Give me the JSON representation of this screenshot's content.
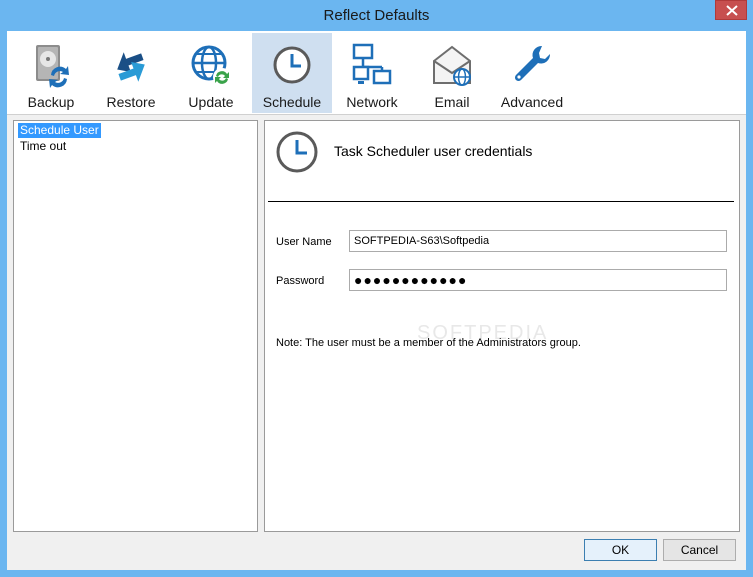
{
  "window": {
    "title": "Reflect Defaults"
  },
  "toolbar": {
    "items": [
      {
        "label": "Backup",
        "icon": "backup-drive-icon",
        "selected": false
      },
      {
        "label": "Restore",
        "icon": "restore-arrows-icon",
        "selected": false
      },
      {
        "label": "Update",
        "icon": "update-globe-icon",
        "selected": false
      },
      {
        "label": "Schedule",
        "icon": "clock-icon",
        "selected": true
      },
      {
        "label": "Network",
        "icon": "network-icon",
        "selected": false
      },
      {
        "label": "Email",
        "icon": "email-icon",
        "selected": false
      },
      {
        "label": "Advanced",
        "icon": "wrench-icon",
        "selected": false
      }
    ]
  },
  "tree": {
    "items": [
      {
        "label": "Schedule User",
        "selected": true
      },
      {
        "label": "Time out",
        "selected": false
      }
    ]
  },
  "panel": {
    "title": "Task Scheduler user credentials",
    "username_label": "User Name",
    "username_value": "SOFTPEDIA-S63\\Softpedia",
    "password_label": "Password",
    "password_value": "●●●●●●●●●●●●",
    "note": "Note: The user must be a member of the Administrators group."
  },
  "watermark": "SOFTPEDIA",
  "buttons": {
    "ok": "OK",
    "cancel": "Cancel"
  },
  "colors": {
    "titlebar": "#6bb6f0",
    "selection": "#3399ff",
    "accent_icon": "#1e6fb8",
    "close": "#c74f4f"
  }
}
